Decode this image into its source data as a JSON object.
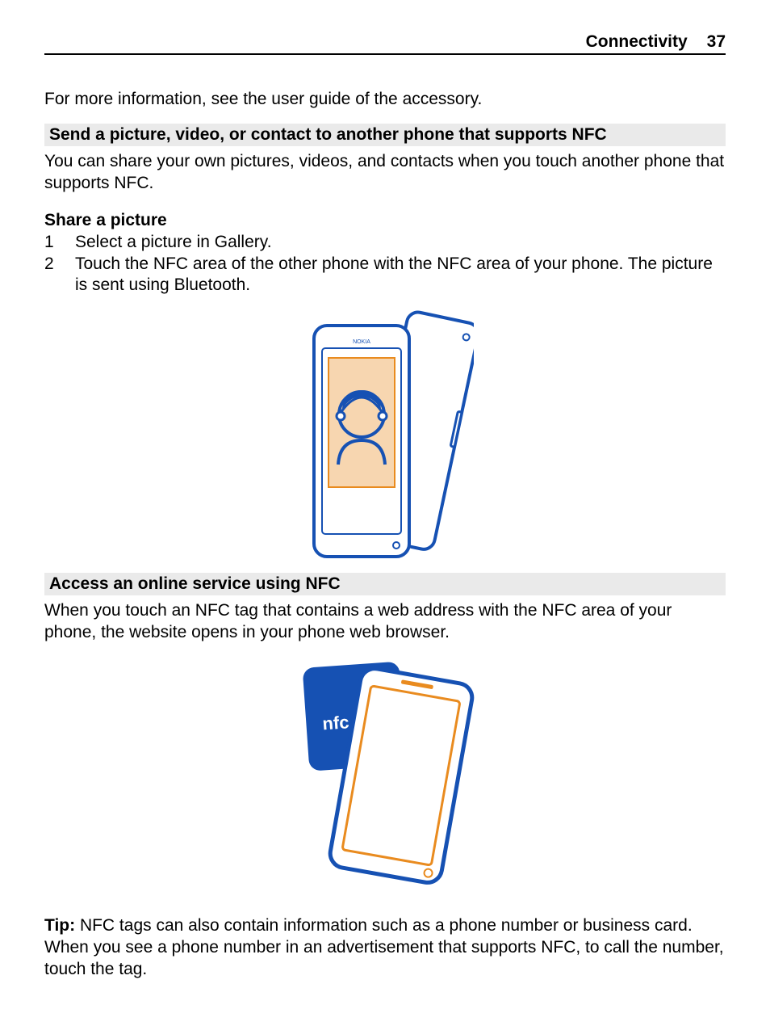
{
  "header": {
    "section": "Connectivity",
    "page_number": "37"
  },
  "intro_para": "For more information, see the user guide of the accessory.",
  "section1": {
    "heading": "Send a picture, video, or contact to another phone that supports NFC",
    "para": "You can share your own pictures, videos, and contacts when you touch another phone that supports NFC."
  },
  "share_picture": {
    "heading": "Share a picture",
    "steps": [
      {
        "n": "1",
        "text": "Select a picture in Gallery."
      },
      {
        "n": "2",
        "text": "Touch the NFC area of the other phone with the NFC area of your phone. The picture is sent using Bluetooth."
      }
    ]
  },
  "illus1": {
    "nokia_label": "NOKIA"
  },
  "section2": {
    "heading": "Access an online service using NFC",
    "para": "When you touch an NFC tag that contains a web address with the NFC area of your phone, the website opens in your phone web browser."
  },
  "illus2": {
    "nfc_label": "nfc"
  },
  "tip": {
    "label": "Tip:",
    "text": " NFC tags can also contain information such as a phone number or business card. When you see a phone number in an advertisement that supports NFC, to call the number, touch the tag."
  }
}
